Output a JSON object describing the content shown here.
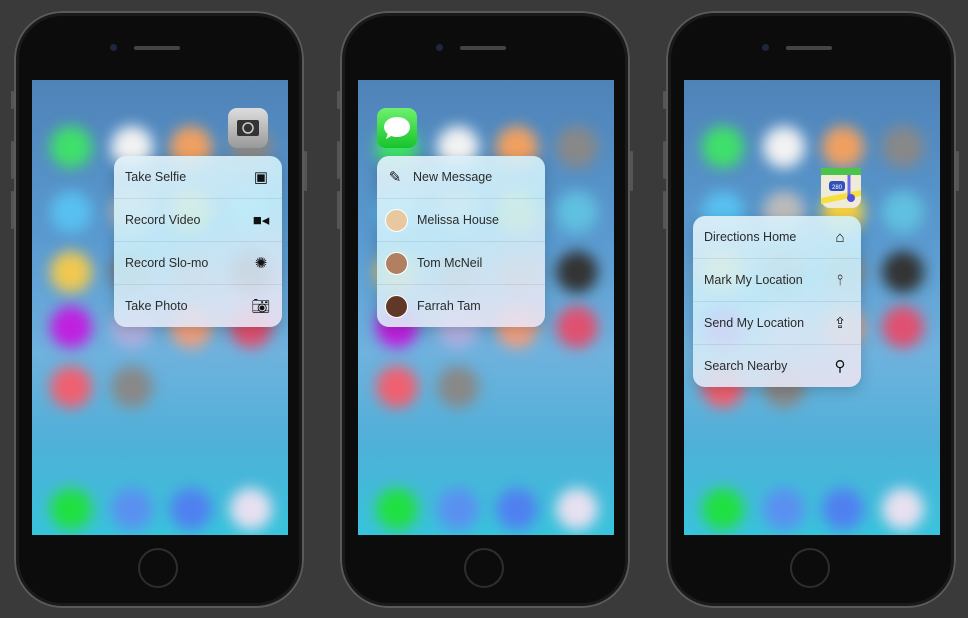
{
  "phones": [
    {
      "app": "Camera",
      "app_icon": "camera-app-icon",
      "menu": [
        {
          "label": "Take Selfie",
          "icon": "selfie-portrait-icon"
        },
        {
          "label": "Record Video",
          "icon": "video-camera-icon"
        },
        {
          "label": "Record Slo-mo",
          "icon": "slo-mo-icon"
        },
        {
          "label": "Take Photo",
          "icon": "camera-icon"
        }
      ]
    },
    {
      "app": "Messages",
      "app_icon": "messages-app-icon",
      "menu": [
        {
          "label": "New Message",
          "icon": "compose-icon"
        },
        {
          "label": "Melissa House",
          "icon": "contact-avatar"
        },
        {
          "label": "Tom McNeil",
          "icon": "contact-avatar"
        },
        {
          "label": "Farrah Tam",
          "icon": "contact-avatar"
        }
      ]
    },
    {
      "app": "Maps",
      "app_icon": "maps-app-icon",
      "shield": "280",
      "menu": [
        {
          "label": "Directions Home",
          "icon": "home-icon"
        },
        {
          "label": "Mark My Location",
          "icon": "pin-icon"
        },
        {
          "label": "Send My Location",
          "icon": "share-icon"
        },
        {
          "label": "Search Nearby",
          "icon": "search-icon"
        }
      ]
    }
  ]
}
